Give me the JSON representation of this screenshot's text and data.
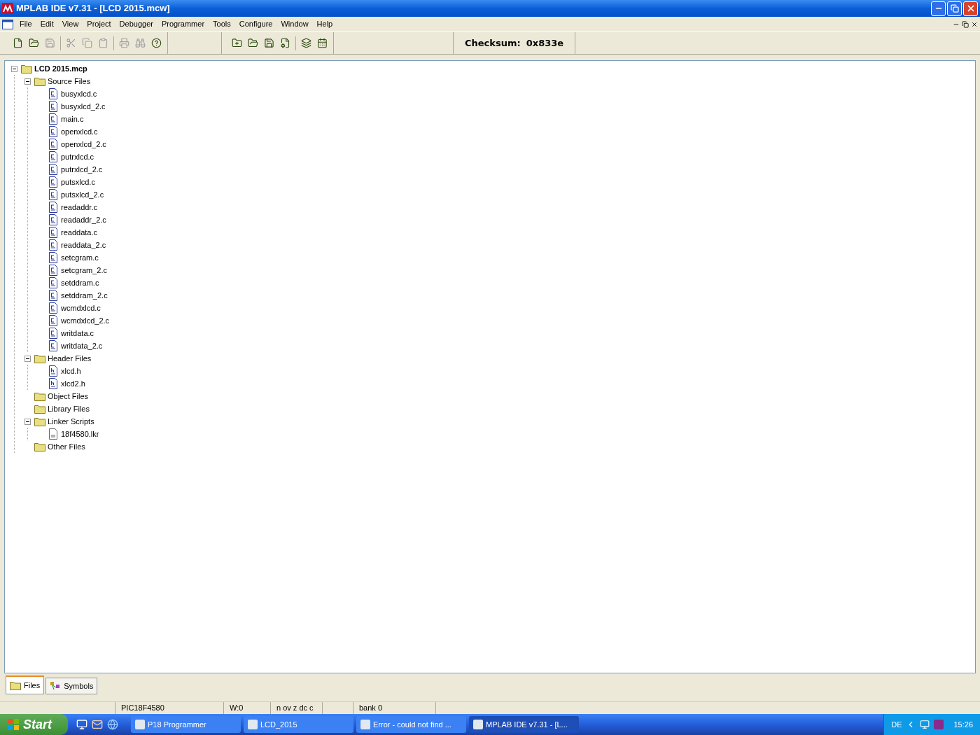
{
  "window": {
    "title": "MPLAB IDE v7.31 - [LCD 2015.mcw]"
  },
  "menu": [
    "File",
    "Edit",
    "View",
    "Project",
    "Debugger",
    "Programmer",
    "Tools",
    "Configure",
    "Window",
    "Help"
  ],
  "toolbar": [
    {
      "disabled": false
    },
    {
      "disabled": false
    },
    {
      "disabled": true
    },
    {
      "disabled": true
    },
    {
      "disabled": true
    },
    {
      "disabled": true
    },
    {
      "disabled": true
    },
    {
      "disabled": true
    },
    {
      "disabled": false
    }
  ],
  "project_toolbar": [
    {
      "disabled": false
    },
    {
      "disabled": false
    },
    {
      "disabled": false
    },
    {
      "disabled": false
    },
    {
      "disabled": false
    },
    {
      "disabled": false
    }
  ],
  "checksum": {
    "label": "Checksum:",
    "value": "0x833e"
  },
  "tree": {
    "label": "LCD 2015.mcp",
    "kind": "project",
    "expanded": true,
    "children": [
      {
        "label": "Source Files",
        "kind": "folder",
        "expanded": true,
        "children": [
          {
            "label": "busyxlcd.c",
            "kind": "c"
          },
          {
            "label": "busyxlcd_2.c",
            "kind": "c"
          },
          {
            "label": "main.c",
            "kind": "c"
          },
          {
            "label": "openxlcd.c",
            "kind": "c"
          },
          {
            "label": "openxlcd_2.c",
            "kind": "c"
          },
          {
            "label": "putrxlcd.c",
            "kind": "c"
          },
          {
            "label": "putrxlcd_2.c",
            "kind": "c"
          },
          {
            "label": "putsxlcd.c",
            "kind": "c"
          },
          {
            "label": "putsxlcd_2.c",
            "kind": "c"
          },
          {
            "label": "readaddr.c",
            "kind": "c"
          },
          {
            "label": "readaddr_2.c",
            "kind": "c"
          },
          {
            "label": "readdata.c",
            "kind": "c"
          },
          {
            "label": "readdata_2.c",
            "kind": "c"
          },
          {
            "label": "setcgram.c",
            "kind": "c"
          },
          {
            "label": "setcgram_2.c",
            "kind": "c"
          },
          {
            "label": "setddram.c",
            "kind": "c"
          },
          {
            "label": "setddram_2.c",
            "kind": "c"
          },
          {
            "label": "wcmdxlcd.c",
            "kind": "c"
          },
          {
            "label": "wcmdxlcd_2.c",
            "kind": "c"
          },
          {
            "label": "writdata.c",
            "kind": "c"
          },
          {
            "label": "writdata_2.c",
            "kind": "c"
          }
        ]
      },
      {
        "label": "Header Files",
        "kind": "folder",
        "expanded": true,
        "children": [
          {
            "label": "xlcd.h",
            "kind": "h"
          },
          {
            "label": "xlcd2.h",
            "kind": "h"
          }
        ]
      },
      {
        "label": "Object Files",
        "kind": "folder"
      },
      {
        "label": "Library Files",
        "kind": "folder"
      },
      {
        "label": "Linker Scripts",
        "kind": "folder",
        "expanded": true,
        "children": [
          {
            "label": "18f4580.lkr",
            "kind": "lkr"
          }
        ]
      },
      {
        "label": "Other Files",
        "kind": "folder"
      }
    ]
  },
  "tabs": [
    {
      "label": "Files",
      "selected": true
    },
    {
      "label": "Symbols",
      "selected": false
    }
  ],
  "status_bar": [
    "PIC18F4580",
    "W:0",
    "n ov z dc c",
    "bank 0"
  ],
  "taskbar": {
    "start": "Start",
    "tasks": [
      {
        "label": "P18 Programmer",
        "selected": false
      },
      {
        "label": "LCD_2015",
        "selected": false
      },
      {
        "label": "Error - could not find ...",
        "selected": false
      },
      {
        "label": "MPLAB IDE v7.31 - [L...",
        "selected": true
      }
    ],
    "language": "DE",
    "clock": "15:26"
  }
}
